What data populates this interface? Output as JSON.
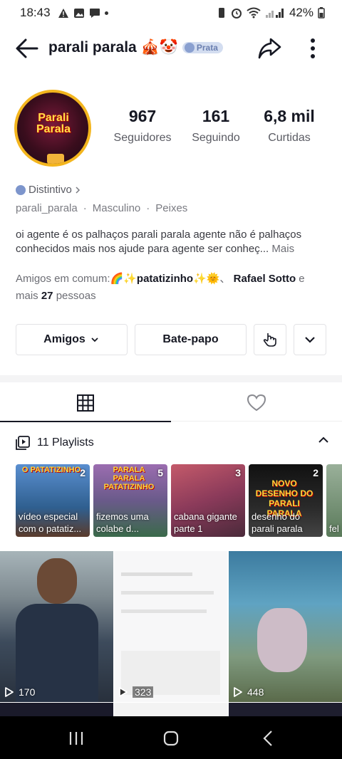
{
  "status": {
    "time": "18:43",
    "battery": "42%"
  },
  "header": {
    "name": "parali parala 🎪🤡",
    "badge": "Prata"
  },
  "stats": [
    {
      "value": "967",
      "label": "Seguidores"
    },
    {
      "value": "161",
      "label": "Seguindo"
    },
    {
      "value": "6,8 mil",
      "label": "Curtidas"
    }
  ],
  "avatar": {
    "logo_line1": "Parali",
    "logo_line2": "Parala"
  },
  "profile": {
    "distintivo": "Distintivo",
    "username": "parali_parala",
    "gender": "Masculino",
    "sign": "Peixes",
    "bio": "oi agente é os palhaços parali parala agente não é palhaços conhecidos mais nos ajude para agente ser conheç...",
    "bio_more": "Mais",
    "friends_prefix": "Amigos em comum:",
    "friend1": "🌈✨patatizinho✨🌞",
    "friend_sep": "、",
    "friend2": "Rafael Sotto",
    "friends_and": " e mais ",
    "friends_count": "27",
    "friends_suffix": " pessoas"
  },
  "buttons": {
    "amigos": "Amigos",
    "bate_papo": "Bate-papo"
  },
  "playlists": {
    "header": "11 Playlists",
    "items": [
      {
        "count": "2",
        "title": "vídeo especial com o patatiz...",
        "banner": "O PATATIZINHO",
        "color": "#3f6fb5"
      },
      {
        "count": "5",
        "title": "fizemos uma colabe d...",
        "banner": "PARALA PARALA PATATIZINHO",
        "color": "#8a5a9a"
      },
      {
        "count": "3",
        "title": "cabana gigante parte 1",
        "banner": "",
        "color": "#b04a5a"
      },
      {
        "count": "2",
        "title": "desenho do parali parala",
        "banner": "NOVO DESENHO DO PARALI PARALA",
        "color": "#222"
      },
      {
        "count": "",
        "title": "fel",
        "banner": "",
        "color": "#6a8a6a"
      }
    ]
  },
  "grid": [
    {
      "views": "170",
      "color": "#6d7c85"
    },
    {
      "views": "323",
      "color": "#f3f3f3"
    },
    {
      "views": "448",
      "color": "#4d8fae"
    }
  ]
}
